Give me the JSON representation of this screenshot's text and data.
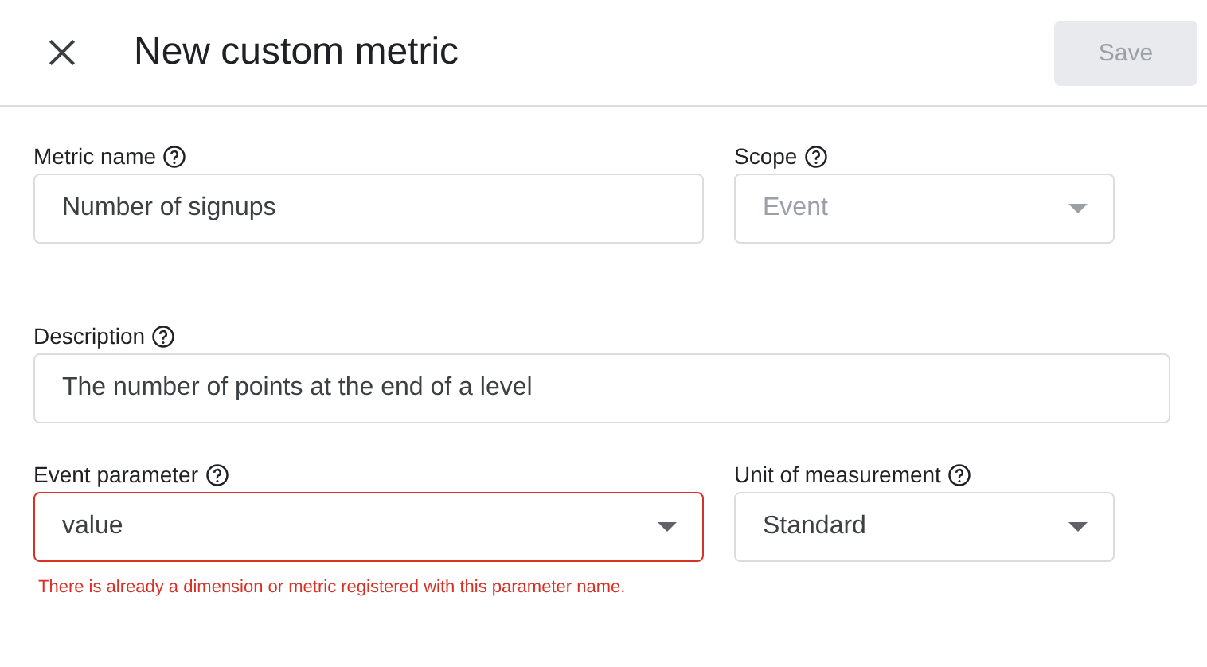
{
  "header": {
    "title": "New custom metric",
    "save_button": {
      "label": "Save",
      "disabled": true
    }
  },
  "rows": [
    {
      "fields": [
        {
          "label": "Metric name",
          "kind": "text",
          "value": "Number of signups",
          "disabled": false
        },
        {
          "label": "Scope",
          "kind": "dropdown",
          "value": "Event",
          "disabled": true
        }
      ]
    },
    {
      "fields": [
        {
          "label": "Description",
          "kind": "text",
          "value": "The number of points at the end of a level",
          "disabled": false
        }
      ]
    },
    {
      "fields": [
        {
          "label": "Event parameter",
          "kind": "dropdown",
          "value": "value",
          "disabled": false,
          "error": "There is already a dimension or metric registered with this parameter name."
        },
        {
          "label": "Unit of measurement",
          "kind": "dropdown",
          "value": "Standard",
          "disabled": false
        }
      ]
    }
  ]
}
